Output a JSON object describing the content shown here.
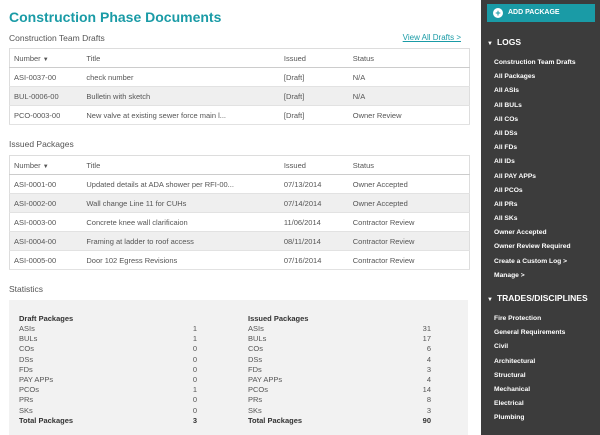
{
  "page_title": "Construction Phase Documents",
  "drafts": {
    "title": "Construction Team Drafts",
    "view_all": "View All Drafts >",
    "columns": {
      "number": "Number",
      "title": "Title",
      "issued": "Issued",
      "status": "Status"
    },
    "rows": [
      {
        "number": "ASI-0037-00",
        "title": "check number",
        "issued": "[Draft]",
        "status": "N/A"
      },
      {
        "number": "BUL-0006-00",
        "title": "Bulletin with sketch",
        "issued": "[Draft]",
        "status": "N/A"
      },
      {
        "number": "PCO-0003-00",
        "title": "New valve at existing sewer force main l...",
        "issued": "[Draft]",
        "status": "Owner Review"
      }
    ]
  },
  "issued": {
    "title": "Issued Packages",
    "columns": {
      "number": "Number",
      "title": "Title",
      "issued": "Issued",
      "status": "Status"
    },
    "rows": [
      {
        "number": "ASI-0001-00",
        "title": "Updated details at ADA shower per RFI-00...",
        "issued": "07/13/2014",
        "status": "Owner Accepted"
      },
      {
        "number": "ASI-0002-00",
        "title": "Wall change Line 11 for CUHs",
        "issued": "07/14/2014",
        "status": "Owner Accepted"
      },
      {
        "number": "ASI-0003-00",
        "title": "Concrete knee wall clarificaion",
        "issued": "11/06/2014",
        "status": "Contractor Review"
      },
      {
        "number": "ASI-0004-00",
        "title": "Framing at ladder to roof access",
        "issued": "08/11/2014",
        "status": "Contractor Review"
      },
      {
        "number": "ASI-0005-00",
        "title": "Door 102 Egress Revisions",
        "issued": "07/16/2014",
        "status": "Contractor Review"
      }
    ]
  },
  "statistics": {
    "title": "Statistics",
    "draft": {
      "heading": "Draft Packages",
      "rows": [
        {
          "label": "ASIs",
          "value": "1"
        },
        {
          "label": "BULs",
          "value": "1"
        },
        {
          "label": "COs",
          "value": "0"
        },
        {
          "label": "DSs",
          "value": "0"
        },
        {
          "label": "FDs",
          "value": "0"
        },
        {
          "label": "PAY APPs",
          "value": "0"
        },
        {
          "label": "PCOs",
          "value": "1"
        },
        {
          "label": "PRs",
          "value": "0"
        },
        {
          "label": "SKs",
          "value": "0"
        }
      ],
      "total_label": "Total Packages",
      "total_value": "3"
    },
    "issued": {
      "heading": "Issued Packages",
      "rows": [
        {
          "label": "ASIs",
          "value": "31"
        },
        {
          "label": "BULs",
          "value": "17"
        },
        {
          "label": "COs",
          "value": "6"
        },
        {
          "label": "DSs",
          "value": "4"
        },
        {
          "label": "FDs",
          "value": "3"
        },
        {
          "label": "PAY APPs",
          "value": "4"
        },
        {
          "label": "PCOs",
          "value": "14"
        },
        {
          "label": "PRs",
          "value": "8"
        },
        {
          "label": "SKs",
          "value": "3"
        }
      ],
      "total_label": "Total Packages",
      "total_value": "90"
    }
  },
  "sidebar": {
    "add_package": "ADD PACKAGE",
    "logs_heading": "LOGS",
    "logs": [
      "Construction Team Drafts",
      "All Packages",
      "All ASIs",
      "All BULs",
      "All COs",
      "All DSs",
      "All FDs",
      "All IDs",
      "All PAY APPs",
      "All PCOs",
      "All PRs",
      "All SKs",
      "Owner Accepted",
      "Owner Review Required",
      "Create a Custom Log >",
      "Manage >"
    ],
    "trades_heading": "TRADES/DISCIPLINES",
    "trades": [
      "Fire Protection",
      "General Requirements",
      "Civil",
      "Architectural",
      "Structural",
      "Mechanical",
      "Electrical",
      "Plumbing"
    ]
  },
  "colors": {
    "accent": "#1a9ba6",
    "sidebar_bg": "#3c3c3c"
  },
  "icons": {
    "sort": "caret-down-icon",
    "add": "plus-circle-icon",
    "section": "caret-down-icon"
  }
}
